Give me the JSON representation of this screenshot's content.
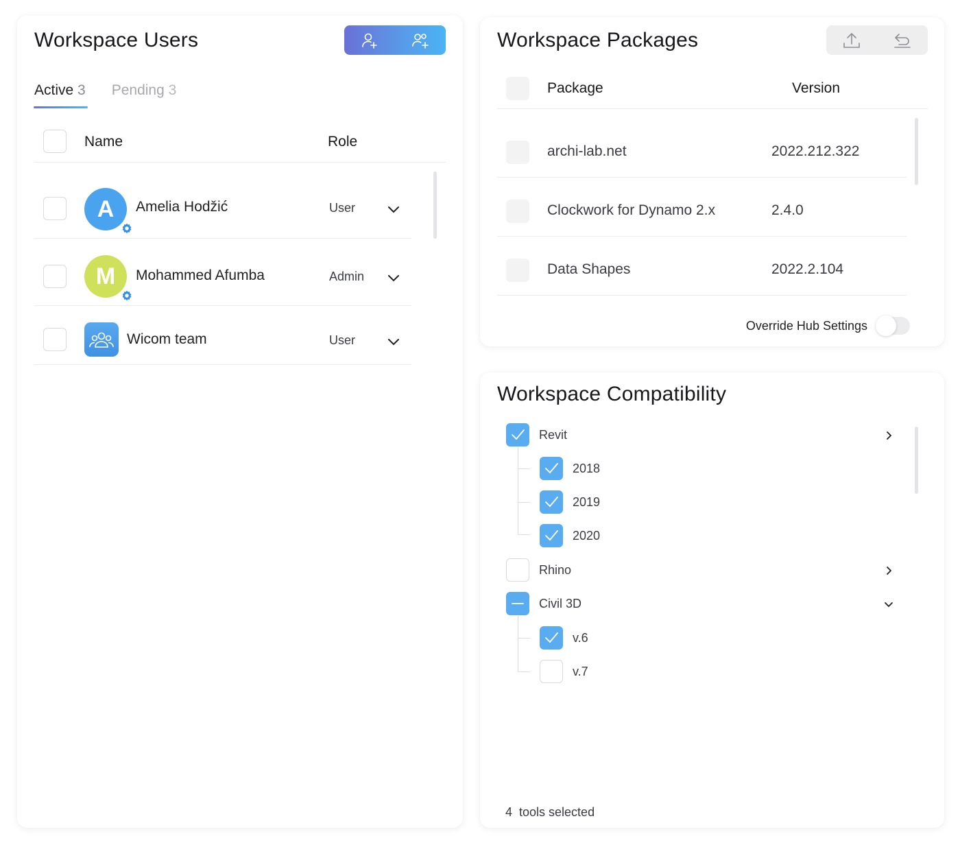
{
  "users_panel": {
    "title": "Workspace Users",
    "tabs": [
      {
        "label": "Active",
        "count": "3"
      },
      {
        "label": "Pending",
        "count": "3"
      }
    ],
    "columns": {
      "name": "Name",
      "role": "Role"
    },
    "rows": [
      {
        "initial": "A",
        "name": "Amelia Hodžić",
        "role": "User",
        "avatar_color": "#4aa3ef"
      },
      {
        "initial": "M",
        "name": "Mohammed Afumba",
        "role": "Admin",
        "avatar_color": "#cfe05a"
      },
      {
        "initial": "",
        "name": "Wicom team",
        "role": "User",
        "avatar_color": "#4f9eea"
      }
    ],
    "header_icons": [
      "add-user-icon",
      "invite-group-icon"
    ]
  },
  "packages_panel": {
    "title": "Workspace Packages",
    "columns": {
      "package": "Package",
      "version": "Version"
    },
    "rows": [
      {
        "name": "archi-lab.net",
        "version": "2022.212.322"
      },
      {
        "name": "Clockwork for Dynamo 2.x",
        "version": "2.4.0"
      },
      {
        "name": "Data Shapes",
        "version": "2022.2.104"
      }
    ],
    "toggle_label": "Override Hub Settings",
    "toggle_on": false,
    "header_icons": [
      "upload-icon",
      "undo-icon"
    ]
  },
  "compat_panel": {
    "title": "Workspace Compatibility",
    "tree": [
      {
        "label": "Revit",
        "state": "checked",
        "expanded": true,
        "children": [
          {
            "label": "2018",
            "state": "checked"
          },
          {
            "label": "2019",
            "state": "checked"
          },
          {
            "label": "2020",
            "state": "checked"
          }
        ]
      },
      {
        "label": "Rhino",
        "state": "unchecked",
        "expanded": false,
        "children": []
      },
      {
        "label": "Civil 3D",
        "state": "indeterminate",
        "expanded": true,
        "children": [
          {
            "label": "v.6",
            "state": "checked"
          },
          {
            "label": "v.7",
            "state": "unchecked"
          }
        ]
      }
    ],
    "footer": "4  tools selected"
  },
  "colors": {
    "accent": "#5aacf0",
    "gradient_start": "#6a71d6",
    "gradient_end": "#4ab4f5"
  }
}
